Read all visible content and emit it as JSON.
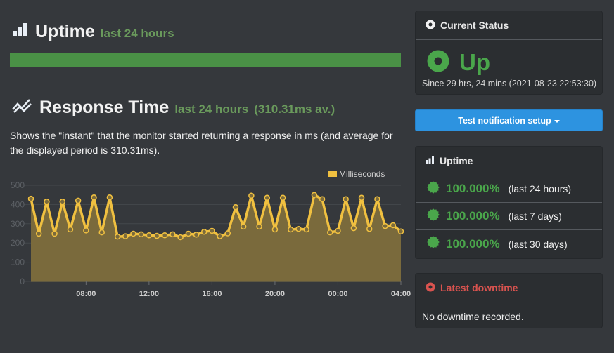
{
  "uptime_section": {
    "title": "Uptime",
    "subtitle": "last 24 hours",
    "bar_fraction": 1.0,
    "bar_color": "#4a9146"
  },
  "response_section": {
    "title": "Response Time",
    "subtitle": "last 24 hours",
    "average": "(310.31ms av.)",
    "description": "Shows the \"instant\" that the monitor started returning a response in ms (and average for the displayed period is 310.31ms)."
  },
  "chart_data": {
    "type": "area",
    "title": "",
    "xlabel": "",
    "ylabel": "",
    "legend": {
      "label": "Milliseconds",
      "placement": "top-right"
    },
    "series_color": "#f0c040",
    "grid": true,
    "ylim": [
      0,
      500
    ],
    "yticks": [
      "0",
      "100",
      "200",
      "300",
      "400",
      "500"
    ],
    "x_start_hour": 4.5,
    "x_step_hours": 0.5,
    "xlim_hours": [
      4.5,
      28
    ],
    "xticks": [
      {
        "hour": 8,
        "label": "08:00"
      },
      {
        "hour": 12,
        "label": "12:00"
      },
      {
        "hour": 16,
        "label": "16:00"
      },
      {
        "hour": 20,
        "label": "20:00"
      },
      {
        "hour": 24,
        "label": "00:00"
      },
      {
        "hour": 28,
        "label": "04:00"
      }
    ],
    "values": [
      430,
      248,
      415,
      248,
      415,
      270,
      420,
      265,
      437,
      255,
      437,
      233,
      235,
      248,
      245,
      240,
      237,
      240,
      245,
      230,
      248,
      243,
      258,
      263,
      235,
      250,
      386,
      285,
      446,
      285,
      435,
      270,
      435,
      270,
      273,
      270,
      450,
      428,
      255,
      263,
      428,
      277,
      435,
      273,
      428,
      288,
      292,
      260
    ]
  },
  "sidebar": {
    "status": {
      "header": "Current Status",
      "state": "Up",
      "since": "Since 29 hrs, 24 mins (2021-08-23 22:53:30)",
      "color": "#4aa64b"
    },
    "notify_button": "Test notification setup",
    "uptime": {
      "header": "Uptime",
      "items": [
        {
          "percent": "100.000%",
          "period": "(last 24 hours)"
        },
        {
          "percent": "100.000%",
          "period": "(last 7 days)"
        },
        {
          "percent": "100.000%",
          "period": "(last 30 days)"
        }
      ]
    },
    "downtime": {
      "header": "Latest downtime",
      "body": "No downtime recorded.",
      "color": "#d9534f"
    }
  }
}
